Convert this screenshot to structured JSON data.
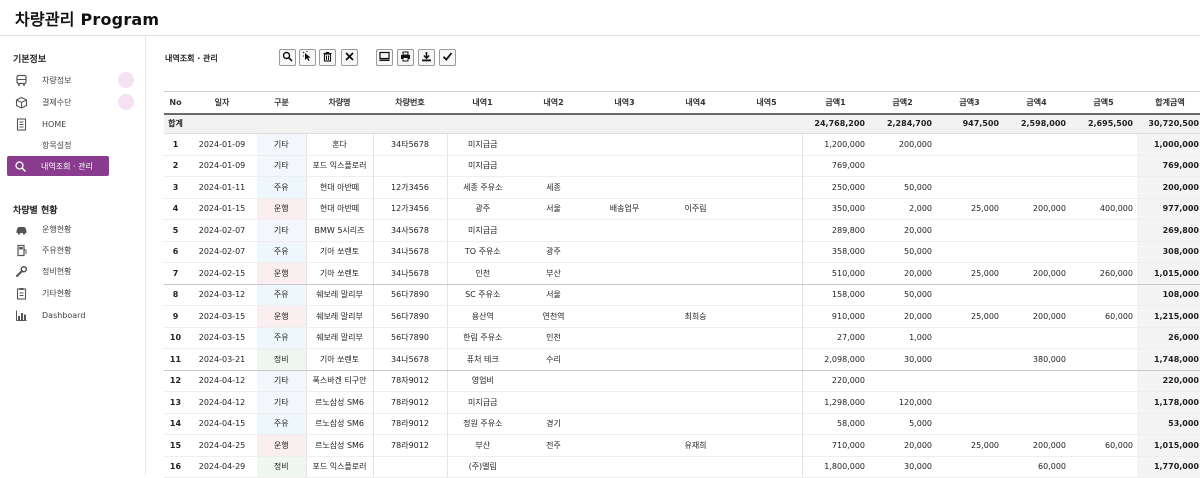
{
  "app": {
    "title": "차량관리 Program"
  },
  "sidebar": {
    "section1_title": "기본정보",
    "section1_items": [
      {
        "label": "차량정보",
        "icon": "bus-icon",
        "badge": true
      },
      {
        "label": "결제수단",
        "icon": "box-icon",
        "badge": true
      },
      {
        "label": "HOME",
        "icon": "document-icon",
        "badge": false
      },
      {
        "label": "항목설정",
        "icon": "",
        "badge": false
      },
      {
        "label": "내역조회 · 관리",
        "icon": "search-icon",
        "active": true
      }
    ],
    "section2_title": "차량별 현황",
    "section2_items": [
      {
        "label": "운행현황",
        "icon": "car-icon"
      },
      {
        "label": "주유현황",
        "icon": "fuel-icon"
      },
      {
        "label": "정비현황",
        "icon": "wrench-icon"
      },
      {
        "label": "기타현황",
        "icon": "clipboard-icon"
      },
      {
        "label": "Dashboard",
        "icon": "bar-chart-icon"
      }
    ]
  },
  "main": {
    "title": "내역조회 · 관리",
    "toolbar": [
      "search-icon",
      "cursor-select-icon",
      "trash-icon",
      "close-icon",
      "monitor-icon",
      "print-icon",
      "download-icon",
      "check-icon"
    ]
  },
  "table": {
    "headers": [
      "No",
      "일자",
      "구분",
      "차량명",
      "차량번호",
      "내역1",
      "내역2",
      "내역3",
      "내역4",
      "내역5",
      "금액1",
      "금액2",
      "금액3",
      "금액4",
      "금액5",
      "합계금액"
    ],
    "summary": {
      "label": "합계",
      "amt1": "24,768,200",
      "amt2": "2,284,700",
      "amt3": "947,500",
      "amt4": "2,598,000",
      "amt5": "2,695,500",
      "total": "30,720,500"
    },
    "rows": [
      {
        "no": "1",
        "date": "2024-01-09",
        "cat": "기타",
        "car": "혼다",
        "plate": "34타5678",
        "d1": "미지급금",
        "d2": "",
        "d3": "",
        "d4": "",
        "d5": "",
        "a1": "1,200,000",
        "a2": "200,000",
        "a3": "",
        "a4": "",
        "a5": "",
        "total": "1,000,000"
      },
      {
        "no": "2",
        "date": "2024-01-09",
        "cat": "기타",
        "car": "포드 익스플로러",
        "plate": "",
        "d1": "미지급금",
        "d2": "",
        "d3": "",
        "d4": "",
        "d5": "",
        "a1": "769,000",
        "a2": "",
        "a3": "",
        "a4": "",
        "a5": "",
        "total": "769,000"
      },
      {
        "no": "3",
        "date": "2024-01-11",
        "cat": "주유",
        "car": "현대 아반떼",
        "plate": "12가3456",
        "d1": "세종 주유소",
        "d2": "세종",
        "d3": "",
        "d4": "",
        "d5": "",
        "a1": "250,000",
        "a2": "50,000",
        "a3": "",
        "a4": "",
        "a5": "",
        "total": "200,000"
      },
      {
        "no": "4",
        "date": "2024-01-15",
        "cat": "운행",
        "car": "현대 아반떼",
        "plate": "12가3456",
        "d1": "광주",
        "d2": "서울",
        "d3": "배송업무",
        "d4": "이주림",
        "d5": "",
        "a1": "350,000",
        "a2": "2,000",
        "a3": "25,000",
        "a4": "200,000",
        "a5": "400,000",
        "total": "977,000"
      },
      {
        "no": "5",
        "date": "2024-02-07",
        "cat": "기타",
        "car": "BMW 5시리즈",
        "plate": "34사5678",
        "d1": "미지급금",
        "d2": "",
        "d3": "",
        "d4": "",
        "d5": "",
        "a1": "289,800",
        "a2": "20,000",
        "a3": "",
        "a4": "",
        "a5": "",
        "total": "269,800"
      },
      {
        "no": "6",
        "date": "2024-02-07",
        "cat": "주유",
        "car": "기아 쏘렌토",
        "plate": "34나5678",
        "d1": "TO 주유소",
        "d2": "광주",
        "d3": "",
        "d4": "",
        "d5": "",
        "a1": "358,000",
        "a2": "50,000",
        "a3": "",
        "a4": "",
        "a5": "",
        "total": "308,000"
      },
      {
        "no": "7",
        "date": "2024-02-15",
        "cat": "운행",
        "car": "기아 쏘렌토",
        "plate": "34나5678",
        "d1": "인천",
        "d2": "부산",
        "d3": "",
        "d4": "",
        "d5": "",
        "a1": "510,000",
        "a2": "20,000",
        "a3": "25,000",
        "a4": "200,000",
        "a5": "260,000",
        "total": "1,015,000"
      },
      {
        "no": "8",
        "date": "2024-03-12",
        "cat": "주유",
        "car": "쉐보레 말리부",
        "plate": "56다7890",
        "d1": "SC 주유소",
        "d2": "서울",
        "d3": "",
        "d4": "",
        "d5": "",
        "a1": "158,000",
        "a2": "50,000",
        "a3": "",
        "a4": "",
        "a5": "",
        "total": "108,000"
      },
      {
        "no": "9",
        "date": "2024-03-15",
        "cat": "운행",
        "car": "쉐보레 말리부",
        "plate": "56다7890",
        "d1": "용산역",
        "d2": "연천역",
        "d3": "",
        "d4": "최희승",
        "d5": "",
        "a1": "910,000",
        "a2": "20,000",
        "a3": "25,000",
        "a4": "200,000",
        "a5": "60,000",
        "total": "1,215,000"
      },
      {
        "no": "10",
        "date": "2024-03-15",
        "cat": "주유",
        "car": "쉐보레 말리부",
        "plate": "56다7890",
        "d1": "한림 주유소",
        "d2": "인천",
        "d3": "",
        "d4": "",
        "d5": "",
        "a1": "27,000",
        "a2": "1,000",
        "a3": "",
        "a4": "",
        "a5": "",
        "total": "26,000"
      },
      {
        "no": "11",
        "date": "2024-03-21",
        "cat": "정비",
        "car": "기아 쏘렌토",
        "plate": "34나5678",
        "d1": "퓨처 테크",
        "d2": "수리",
        "d3": "",
        "d4": "",
        "d5": "",
        "a1": "2,098,000",
        "a2": "30,000",
        "a3": "",
        "a4": "380,000",
        "a5": "",
        "total": "1,748,000"
      },
      {
        "no": "12",
        "date": "2024-04-12",
        "cat": "기타",
        "car": "폭스바겐 티구안",
        "plate": "78자9012",
        "d1": "영업비",
        "d2": "",
        "d3": "",
        "d4": "",
        "d5": "",
        "a1": "220,000",
        "a2": "",
        "a3": "",
        "a4": "",
        "a5": "",
        "total": "220,000"
      },
      {
        "no": "13",
        "date": "2024-04-12",
        "cat": "기타",
        "car": "르노삼성 SM6",
        "plate": "78라9012",
        "d1": "미지급금",
        "d2": "",
        "d3": "",
        "d4": "",
        "d5": "",
        "a1": "1,298,000",
        "a2": "120,000",
        "a3": "",
        "a4": "",
        "a5": "",
        "total": "1,178,000"
      },
      {
        "no": "14",
        "date": "2024-04-15",
        "cat": "주유",
        "car": "르노삼성 SM6",
        "plate": "78라9012",
        "d1": "정원 주유소",
        "d2": "경기",
        "d3": "",
        "d4": "",
        "d5": "",
        "a1": "58,000",
        "a2": "5,000",
        "a3": "",
        "a4": "",
        "a5": "",
        "total": "53,000"
      },
      {
        "no": "15",
        "date": "2024-04-25",
        "cat": "운행",
        "car": "르노삼성 SM6",
        "plate": "78라9012",
        "d1": "부산",
        "d2": "전주",
        "d3": "",
        "d4": "유재희",
        "d5": "",
        "a1": "710,000",
        "a2": "20,000",
        "a3": "25,000",
        "a4": "200,000",
        "a5": "60,000",
        "total": "1,015,000"
      },
      {
        "no": "16",
        "date": "2024-04-29",
        "cat": "정비",
        "car": "포드 익스플로러",
        "plate": "",
        "d1": "(주)엘림",
        "d2": "",
        "d3": "",
        "d4": "",
        "d5": "",
        "a1": "1,800,000",
        "a2": "30,000",
        "a3": "",
        "a4": "60,000",
        "a5": "",
        "total": "1,770,000"
      }
    ]
  }
}
